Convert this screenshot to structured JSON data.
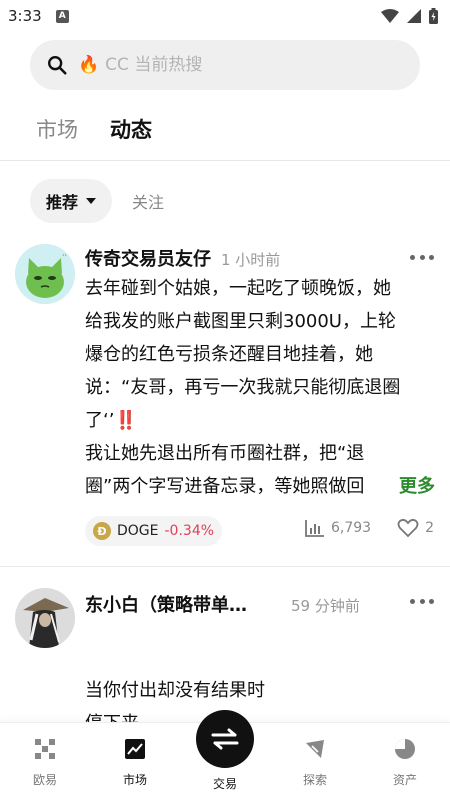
{
  "status_bar": {
    "time": "3:33",
    "notif_icon": "A"
  },
  "search": {
    "placeholder": "CC 当前热搜",
    "fire_icon": "🔥"
  },
  "main_tabs": [
    {
      "label": "市场"
    },
    {
      "label": "动态"
    }
  ],
  "sub_tabs": {
    "recommend": "推荐",
    "follow": "关注"
  },
  "posts": [
    {
      "author": "传奇交易员友仔",
      "time": "1 小时前",
      "lines": [
        "去年碰到个姑娘，一起吃了顿晚饭，她",
        "给我发的账户截图里只剩3000U，上轮",
        "爆仓的红色亏损条还醒目地挂着，她",
        "说：“友哥，再亏一次我就只能彻底退圈",
        "了‘’‼️",
        "我让她先退出所有币圈社群，把“退",
        "圈”两个字写进备忘录，等她照做回"
      ],
      "expand_label": "更多",
      "coin": {
        "symbol": "DOGE",
        "change": "-0.34%"
      },
      "views": "6,793",
      "likes": "2"
    },
    {
      "author": "东小白（策略带单…",
      "time": "59 分钟前",
      "lines": [
        "当你付出却没有结果时",
        "停下来"
      ]
    }
  ],
  "nav": [
    {
      "label": "欧易"
    },
    {
      "label": "市场"
    },
    {
      "label": "交易"
    },
    {
      "label": "探索"
    },
    {
      "label": "资产"
    }
  ],
  "colors": {
    "accent_green": "#2d8a2d",
    "negative_red": "#e0405a"
  }
}
